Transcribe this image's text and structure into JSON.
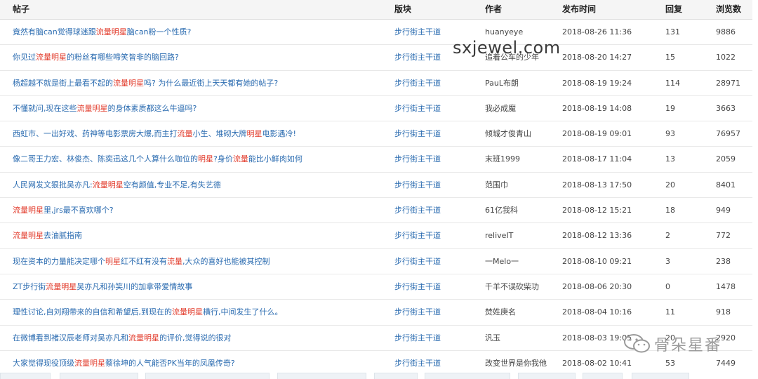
{
  "header": {
    "title": "帖子",
    "board": "版块",
    "author": "作者",
    "time": "发布时间",
    "reply": "回复",
    "views": "浏览数"
  },
  "rows": [
    {
      "title_parts": [
        [
          "竟然有脑can觉得球迷跟",
          0
        ],
        [
          "流量明星",
          1
        ],
        [
          "脑can粉一个性质?",
          0
        ]
      ],
      "board": "步行街主干道",
      "author": "huanyeye",
      "time": "2018-08-26 11:36",
      "reply": "131",
      "views": "9886"
    },
    {
      "title_parts": [
        [
          "你见过",
          0
        ],
        [
          "流量明星",
          1
        ],
        [
          "的粉丝有哪些啼笑皆非的脑回路?",
          0
        ]
      ],
      "board": "步行街主干道",
      "author": "追着公车的少年",
      "time": "2018-08-20 14:27",
      "reply": "15",
      "views": "1022"
    },
    {
      "title_parts": [
        [
          "杨超越不就是街上最看不起的",
          0
        ],
        [
          "流量明星",
          1
        ],
        [
          "吗? 为什么最近街上天天都有她的帖子?",
          0
        ]
      ],
      "board": "步行街主干道",
      "author": "PauL布朗",
      "time": "2018-08-19 19:24",
      "reply": "114",
      "views": "28971"
    },
    {
      "title_parts": [
        [
          "不懂就问,现在这些",
          0
        ],
        [
          "流量明星",
          1
        ],
        [
          "的身体素质都这么牛逼吗?",
          0
        ]
      ],
      "board": "步行街主干道",
      "author": "我必成魔",
      "time": "2018-08-19 14:08",
      "reply": "19",
      "views": "3663"
    },
    {
      "title_parts": [
        [
          "西虹市、一出好戏、药神等电影票房大爆,而主打",
          0
        ],
        [
          "流量",
          1
        ],
        [
          "小生、堆砌大牌",
          0
        ],
        [
          "明星",
          1
        ],
        [
          "电影遇冷!",
          0
        ]
      ],
      "board": "步行街主干道",
      "author": "倾城才俊青山",
      "time": "2018-08-19 09:01",
      "reply": "93",
      "views": "76957"
    },
    {
      "title_parts": [
        [
          "像二哥王力宏、林俊杰、陈奕迅这几个人算什么咖位的",
          0
        ],
        [
          "明星",
          1
        ],
        [
          "?身价",
          0
        ],
        [
          "流量",
          1
        ],
        [
          "能比小鲜肉如何",
          0
        ]
      ],
      "board": "步行街主干道",
      "author": "末班1999",
      "time": "2018-08-17 11:04",
      "reply": "13",
      "views": "2059"
    },
    {
      "title_parts": [
        [
          "人民网发文狠批吴亦凡:",
          0
        ],
        [
          "流量明星",
          1
        ],
        [
          "空有颜值,专业不足,有失艺德",
          0
        ]
      ],
      "board": "步行街主干道",
      "author": "范围巾",
      "time": "2018-08-13 17:50",
      "reply": "20",
      "views": "8401"
    },
    {
      "title_parts": [
        [
          "流量明星",
          1
        ],
        [
          "里,jrs最不喜欢哪个?",
          0
        ]
      ],
      "board": "步行街主干道",
      "author": "61亿我科",
      "time": "2018-08-12 15:21",
      "reply": "18",
      "views": "949"
    },
    {
      "title_parts": [
        [
          "流量明星",
          1
        ],
        [
          "去油腻指南",
          0
        ]
      ],
      "board": "步行街主干道",
      "author": "reliveIT",
      "time": "2018-08-12 13:36",
      "reply": "2",
      "views": "772"
    },
    {
      "title_parts": [
        [
          "现在资本的力量能决定哪个",
          0
        ],
        [
          "明星",
          1
        ],
        [
          "红不红有没有",
          0
        ],
        [
          "流量",
          1
        ],
        [
          ",大众的喜好也能被其控制",
          0
        ]
      ],
      "board": "步行街主干道",
      "author": "一Melo一",
      "time": "2018-08-10 09:21",
      "reply": "3",
      "views": "238"
    },
    {
      "title_parts": [
        [
          "ZT步行街",
          0
        ],
        [
          "流量明星",
          1
        ],
        [
          "吴亦凡和孙笑川的加拿带爱情故事",
          0
        ]
      ],
      "board": "步行街主干道",
      "author": "千羊不误砍柴功",
      "time": "2018-08-06 20:30",
      "reply": "0",
      "views": "1478"
    },
    {
      "title_parts": [
        [
          "理性讨论,自刘翔带来的自信和希望后,到现在的",
          0
        ],
        [
          "流量明星",
          1
        ],
        [
          "横行,中间发生了什么。",
          0
        ]
      ],
      "board": "步行街主干道",
      "author": "焚姓庚名",
      "time": "2018-08-04 10:16",
      "reply": "11",
      "views": "918"
    },
    {
      "title_parts": [
        [
          "在微博看到褚汉辰老师对吴亦凡和",
          0
        ],
        [
          "流量明星",
          1
        ],
        [
          "的评价,觉得说的很对",
          0
        ]
      ],
      "board": "步行街主干道",
      "author": "汎玉",
      "time": "2018-08-03 19:05",
      "reply": "20",
      "views": "2920"
    },
    {
      "title_parts": [
        [
          "大家觉得现役顶级",
          0
        ],
        [
          "流量明星",
          1
        ],
        [
          "蔡徐坤的人气能否PK当年的凤凰传奇?",
          0
        ]
      ],
      "board": "步行街主干道",
      "author": "改变世界是你我他",
      "time": "2018-08-02 10:41",
      "reply": "53",
      "views": "7449"
    }
  ],
  "watermark": "sxjewel.com",
  "logo_text": "骨朵星番",
  "colors": {
    "link": "#2a6bb0",
    "highlight": "#e23b2b",
    "header_bg": "#f5f5f5"
  }
}
